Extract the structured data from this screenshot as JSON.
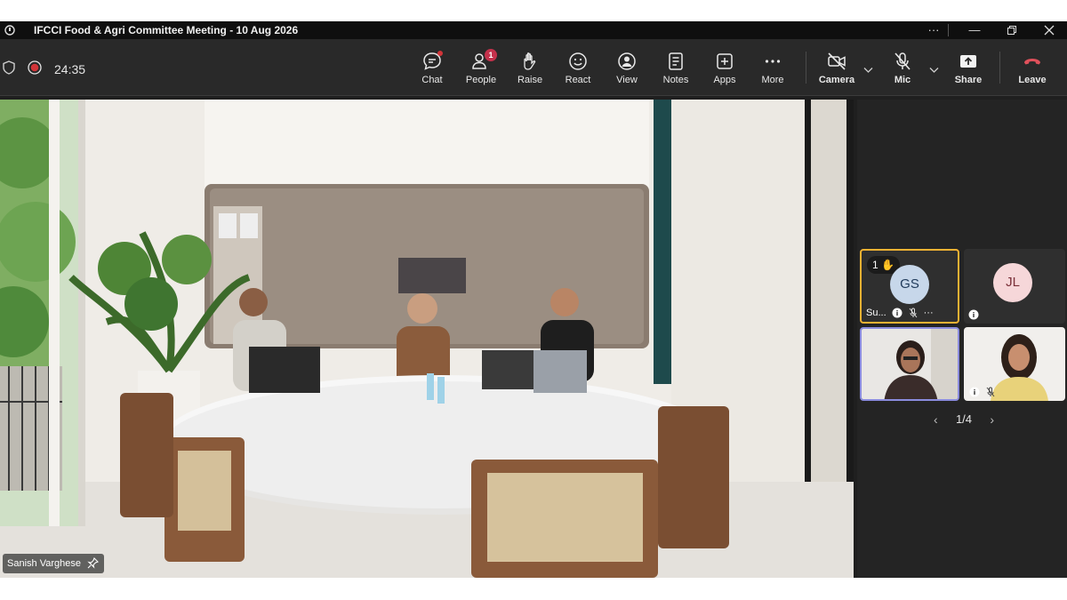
{
  "window": {
    "title": "IFCCI Food & Agri Committee Meeting - 10 Aug 2026",
    "controls": [
      "more",
      "minimize",
      "restore",
      "close"
    ]
  },
  "toolbar": {
    "timer": "24:35",
    "buttons": [
      {
        "id": "chat",
        "label": "Chat",
        "icon": "chat-icon"
      },
      {
        "id": "people",
        "label": "People",
        "icon": "people-icon",
        "badge": "1"
      },
      {
        "id": "raise",
        "label": "Raise",
        "icon": "hand-icon"
      },
      {
        "id": "react",
        "label": "React",
        "icon": "smile-icon"
      },
      {
        "id": "view",
        "label": "View",
        "icon": "view-icon"
      },
      {
        "id": "notes",
        "label": "Notes",
        "icon": "notes-icon"
      },
      {
        "id": "apps",
        "label": "Apps",
        "icon": "apps-icon"
      },
      {
        "id": "more",
        "label": "More",
        "icon": "more-icon"
      },
      {
        "id": "camera",
        "label": "Camera",
        "icon": "camera-off-icon"
      },
      {
        "id": "mic",
        "label": "Mic",
        "icon": "mic-off-icon"
      },
      {
        "id": "share",
        "label": "Share",
        "icon": "share-icon"
      },
      {
        "id": "leave",
        "label": "Leave",
        "icon": "hangup-icon"
      }
    ],
    "colors": {
      "leave": "#e0515b",
      "recording": "#d13438"
    }
  },
  "main_video": {
    "pinned_name": "Sanish Varghese"
  },
  "participants": [
    {
      "initials": "GS",
      "name": "Su...",
      "hand_count": "1",
      "avatar_color": "#c7d7ea",
      "raised_hand": true
    },
    {
      "initials": "JL",
      "avatar_color": "#f6d7d9"
    },
    {
      "video": true,
      "speaking": true
    },
    {
      "video": true
    }
  ],
  "pager": {
    "label": "1/4"
  }
}
